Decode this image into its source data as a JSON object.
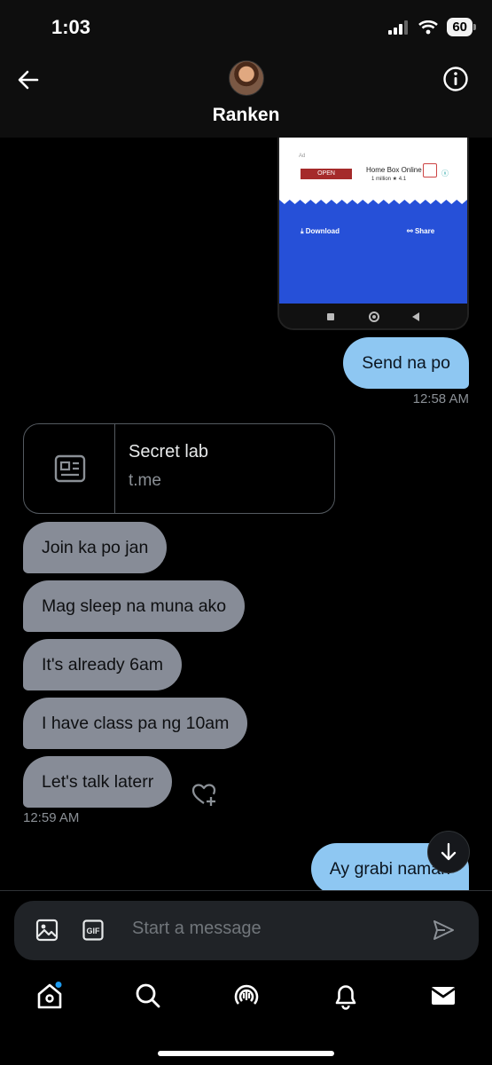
{
  "status_bar": {
    "time": "1:03",
    "battery": "60"
  },
  "header": {
    "contact_name": "Ranken"
  },
  "shared_screenshot": {
    "ad_label": "Ad",
    "ad_button": "OPEN",
    "ad_app_name": "Home Box Online",
    "ad_meta": "1 million ★ 4.1",
    "download_label": "Download",
    "share_label": "Share"
  },
  "messages": {
    "sent_1": "Send na po",
    "sent_1_time": "12:58 AM",
    "link_card": {
      "title": "Secret lab",
      "domain": "t.me"
    },
    "recv_1": "Join ka po jan",
    "recv_2": "Mag sleep na muna ako",
    "recv_3": "It's already 6am",
    "recv_4": "I have class pa ng 10am",
    "recv_5": "Let's talk laterr",
    "recv_time": "12:59 AM",
    "sent_2": "Ay grabi naman"
  },
  "composer": {
    "placeholder": "Start a message"
  },
  "colors": {
    "sent_bubble": "#8ec7f2",
    "recv_bubble": "#878c97",
    "accent": "#1d9bf0"
  }
}
